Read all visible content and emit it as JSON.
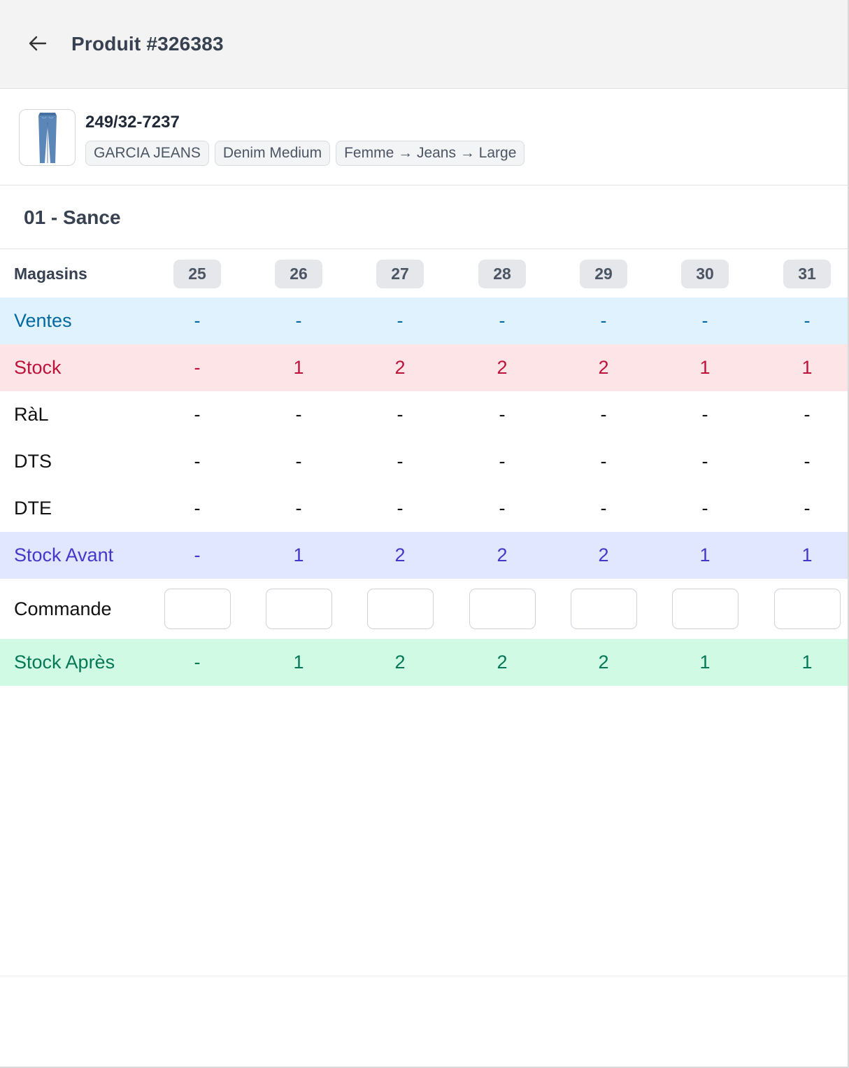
{
  "header": {
    "title": "Produit #326383",
    "back_icon": "arrow-left-icon"
  },
  "product": {
    "reference": "249/32-7237",
    "image": "jeans-thumbnail",
    "tags": [
      "GARCIA JEANS",
      "Denim Medium",
      "Femme → Jeans → Large"
    ]
  },
  "store": {
    "title": "01 - Sance"
  },
  "grid": {
    "header_label": "Magasins",
    "sizes": [
      "25",
      "26",
      "27",
      "28",
      "29",
      "30",
      "31"
    ],
    "rows": {
      "ventes": {
        "label": "Ventes",
        "values": [
          "-",
          "-",
          "-",
          "-",
          "-",
          "-",
          "-"
        ],
        "color": "#0369a1"
      },
      "stock": {
        "label": "Stock",
        "values": [
          "-",
          "1",
          "2",
          "2",
          "2",
          "1",
          "1"
        ],
        "color": "#be123c"
      },
      "ral": {
        "label": "RàL",
        "values": [
          "-",
          "-",
          "-",
          "-",
          "-",
          "-",
          "-"
        ]
      },
      "dts": {
        "label": "DTS",
        "values": [
          "-",
          "-",
          "-",
          "-",
          "-",
          "-",
          "-"
        ]
      },
      "dte": {
        "label": "DTE",
        "values": [
          "-",
          "-",
          "-",
          "-",
          "-",
          "-",
          "-"
        ]
      },
      "avant": {
        "label": "Stock Avant",
        "values": [
          "-",
          "1",
          "2",
          "2",
          "2",
          "1",
          "1"
        ],
        "color": "#4338ca"
      },
      "commande": {
        "label": "Commande",
        "values": [
          "",
          "",
          "",
          "",
          "",
          "",
          ""
        ]
      },
      "apres": {
        "label": "Stock Après",
        "values": [
          "-",
          "1",
          "2",
          "2",
          "2",
          "1",
          "1"
        ],
        "color": "#047857"
      }
    }
  }
}
